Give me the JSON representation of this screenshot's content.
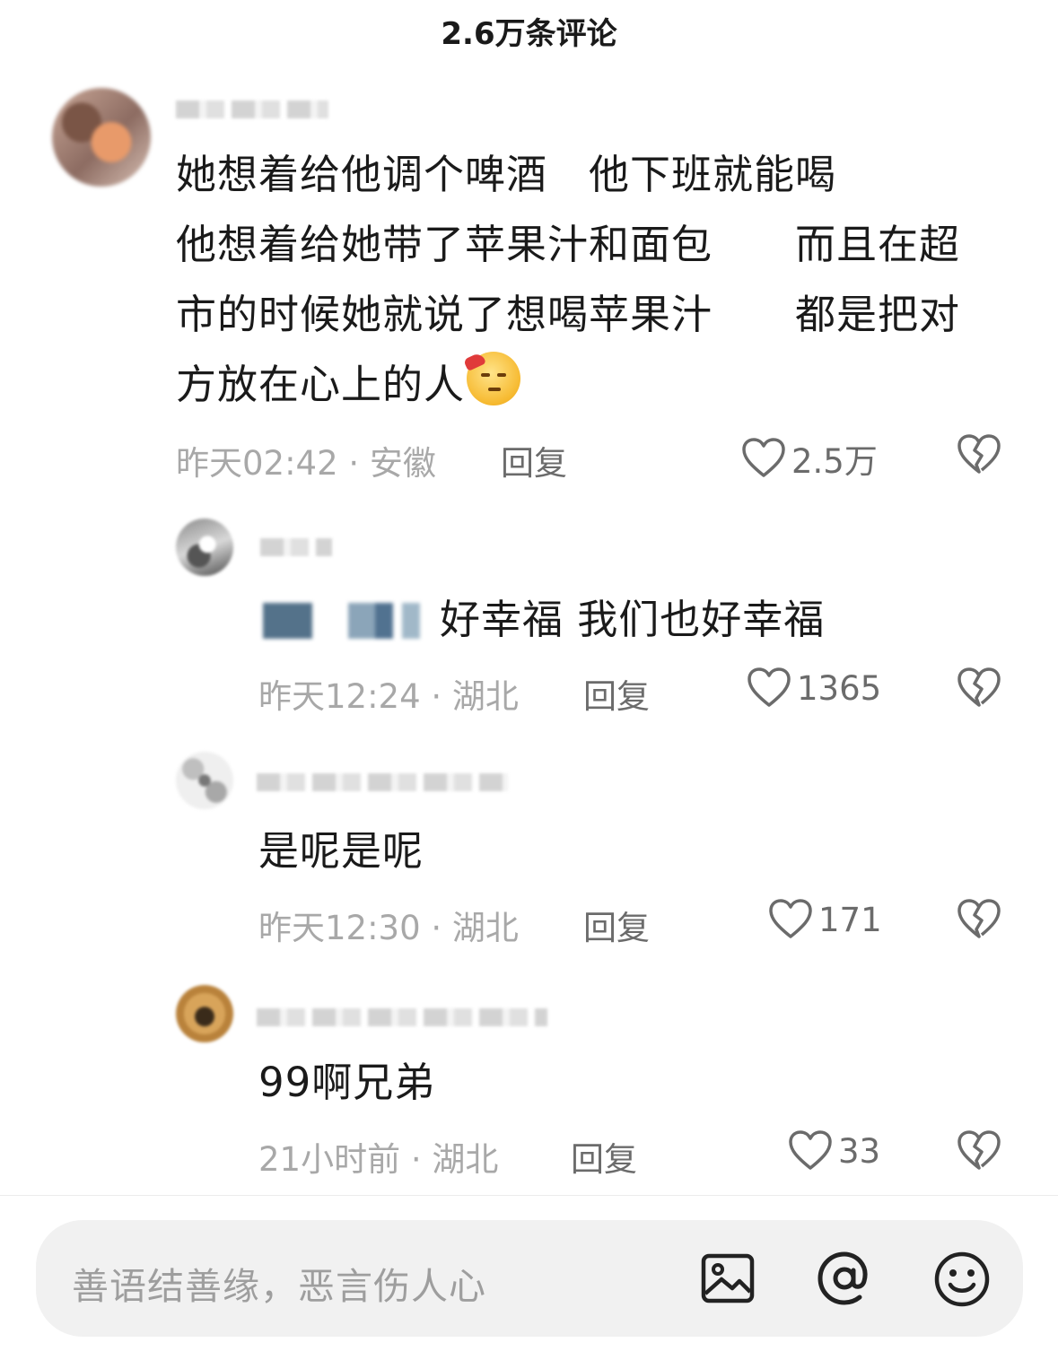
{
  "header": {
    "title": "2.6万条评论"
  },
  "comments": [
    {
      "lines": [
        "她想着给他调个啤酒　他下班就能喝",
        "他想着给她带了苹果汁和面包　　而且在超",
        "市的时候她就说了想喝苹果汁　　都是把对",
        "方放在心上的人"
      ],
      "time_location": "昨天02:42 · 安徽",
      "reply_label": "回复",
      "likes": "2.5万"
    },
    {
      "text": "好幸福 我们也好幸福",
      "time_location": "昨天12:24 · 湖北",
      "reply_label": "回复",
      "likes": "1365"
    },
    {
      "text": "是呢是呢",
      "time_location": "昨天12:30 · 湖北",
      "reply_label": "回复",
      "likes": "171"
    },
    {
      "text": "99啊兄弟",
      "time_location": "21小时前 · 湖北",
      "reply_label": "回复",
      "likes": "33"
    }
  ],
  "input": {
    "placeholder": "善语结善缘，恶言伤人心"
  },
  "icons": {
    "like": "heart-outline-icon",
    "dislike": "broken-heart-icon",
    "image": "image-icon",
    "mention": "at-icon",
    "emoji": "smiley-icon"
  }
}
